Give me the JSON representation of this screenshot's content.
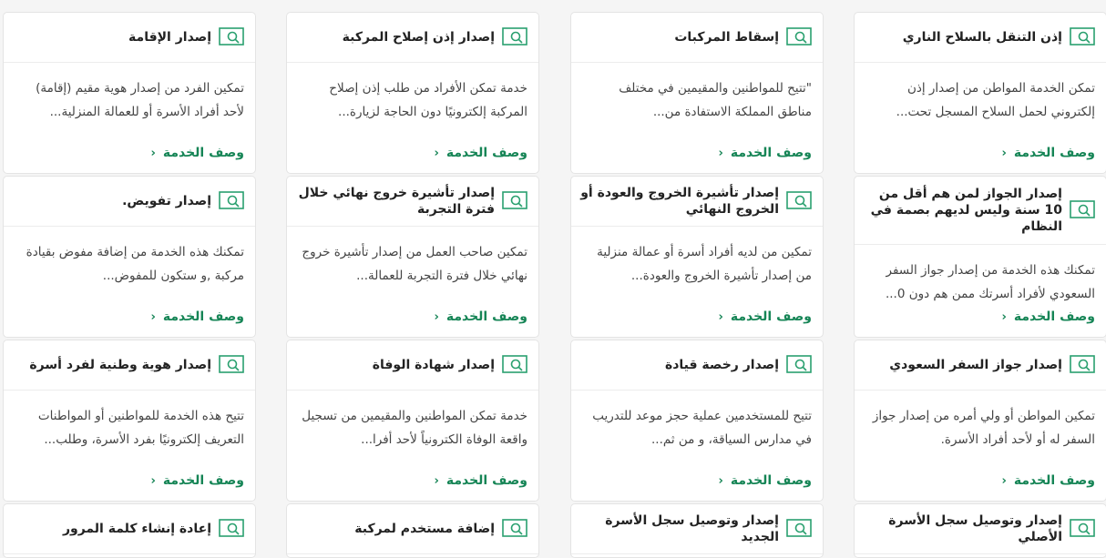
{
  "services": [
    {
      "title": "إذن التنقل بالسلاح الناري",
      "desc": "تمكن الخدمة المواطن من إصدار إذن إلكتروني لحمل السلاح المسجل تحت..."
    },
    {
      "title": "إسقاط المركبات",
      "desc": "\"تتيح للمواطنين والمقيمين في مختلف مناطق المملكة الاستفادة من..."
    },
    {
      "title": "إصدار إذن إصلاح المركبة",
      "desc": "خدمة تمكن الأفراد من طلب إذن إصلاح المركبة إلكترونيًا دون الحاجة لزيارة..."
    },
    {
      "title": "إصدار الإقامة",
      "desc": "تمكين الفرد من إصدار هوية مقيم (إقامة) لأحد أفراد الأسرة أو للعمالة المنزلية..."
    },
    {
      "title": "إصدار الجواز لمن هم أقل من 10 سنة وليس لديهم بصمة في النظام",
      "desc": "تمكنك هذه الخدمة من إصدار جواز السفر السعودي لأفراد أسرتك ممن هم دون 0..."
    },
    {
      "title": "إصدار تأشيرة الخروج والعودة أو الخروج النهائي",
      "desc": "تمكين من لديه أفراد أسرة أو عمالة منزلية من إصدار تأشيرة الخروج والعودة..."
    },
    {
      "title": "إصدار تأشيرة خروج نهائي خلال فترة التجربة",
      "desc": "تمكين صاحب العمل من إصدار تأشيرة خروج نهائي خلال فترة التجربة للعمالة..."
    },
    {
      "title": "إصدار تفويض.",
      "desc": "تمكنك هذه الخدمة من إضافة مفوض بقيادة مركبة ,و ستكون للمفوض..."
    },
    {
      "title": "إصدار جواز السفر السعودي",
      "desc": "تمكين المواطن أو ولي أمره من إصدار جواز السفر له أو لأحد أفراد الأسرة."
    },
    {
      "title": "إصدار رخصة قيادة",
      "desc": "تتيح للمستخدمين عملية حجز موعد للتدريب في مدارس السياقة، و من ثم..."
    },
    {
      "title": "إصدار شهادة الوفاة",
      "desc": "خدمة تمكن المواطنين والمقيمين من تسجيل واقعة الوفاة الكترونياً لأحد أفرا..."
    },
    {
      "title": "إصدار هوية وطنية لفرد أسرة",
      "desc": "تتيح هذه الخدمة للمواطنين أو المواطنات التعريف إلكترونيًا بفرد الأسرة، وطلب..."
    },
    {
      "title": "إصدار وتوصيل سجل الأسرة الأصلي",
      "desc": ""
    },
    {
      "title": "إصدار وتوصيل سجل الأسرة الجديد",
      "desc": ""
    },
    {
      "title": "إضافة مستخدم لمركبة",
      "desc": ""
    },
    {
      "title": "إعادة إنشاء كلمة المرور",
      "desc": ""
    }
  ],
  "more_label": "وصف الخدمة",
  "chevron": "‹",
  "colors": {
    "accent": "#168556",
    "icon": "#2aa06f"
  }
}
